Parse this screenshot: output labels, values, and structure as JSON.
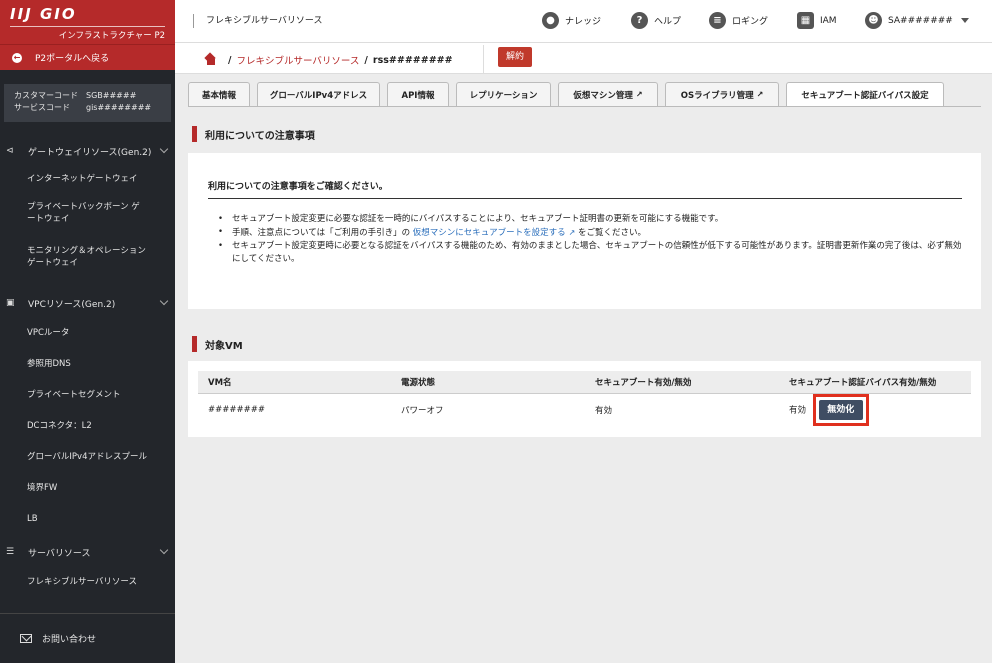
{
  "sidebar": {
    "logo": "IIJ GIO",
    "logo_sub": "インフラストラクチャー P2",
    "back_label": "P2ポータルへ戻る",
    "customer_code_label": "カスタマーコード",
    "customer_code_value": "SGB#####",
    "service_code_label": "サービスコード",
    "service_code_value": "gis########",
    "sections": [
      {
        "label": "ゲートウェイリソース(Gen.2)",
        "items": [
          "インターネットゲートウェイ",
          "プライベートバックボーン ゲートウェイ",
          "モニタリング＆オペレーション ゲートウェイ"
        ]
      },
      {
        "label": "VPCリソース(Gen.2)",
        "items": [
          "VPCルータ",
          "参照用DNS",
          "プライベートセグメント",
          "DCコネクタ：L2",
          "グローバルIPv4アドレスプール",
          "境界FW",
          "LB"
        ]
      },
      {
        "label": "サーバリソース",
        "items": [
          "フレキシブルサーバリソース"
        ]
      }
    ],
    "contact_label": "お問い合わせ"
  },
  "header": {
    "title": "フレキシブルサーバリソース",
    "nav": {
      "knowledge": "ナレッジ",
      "help": "ヘルプ",
      "logging": "ロギング",
      "iam": "IAM",
      "user": "SA#######"
    }
  },
  "breadcrumb": {
    "link": "フレキシブルサーバリソース",
    "current": "rss########",
    "cancel_button": "解約"
  },
  "tabs": [
    "基本情報",
    "グローバルIPv4アドレス",
    "API情報",
    "レプリケーション",
    "仮想マシン管理",
    "OSライブラリ管理",
    "セキュアブート認証バイパス設定"
  ],
  "notice": {
    "heading": "利用についての注意事項",
    "title": "利用についての注意事項をご確認ください。",
    "bullet1": "セキュアブート設定変更に必要な認証を一時的にバイパスすることにより、セキュアブート証明書の更新を可能にする機能です。",
    "bullet2_pre": "手順、注意点については「ご利用の手引き」の",
    "bullet2_link": "仮想マシンにセキュアブートを設定する",
    "bullet2_post": "をご覧ください。",
    "bullet3": "セキュアブート設定変更時に必要となる認証をバイパスする機能のため、有効のままとした場合、セキュアブートの信頼性が低下する可能性があります。証明書更新作業の完了後は、必ず無効にしてください。"
  },
  "target_vm": {
    "heading": "対象VM",
    "columns": [
      "VM名",
      "電源状態",
      "セキュアブート有効/無効",
      "セキュアブート認証バイパス有効/無効"
    ],
    "row": {
      "name": "########",
      "power": "パワーオフ",
      "secure_boot": "有効",
      "bypass": "有効",
      "disable_button": "無効化"
    }
  }
}
